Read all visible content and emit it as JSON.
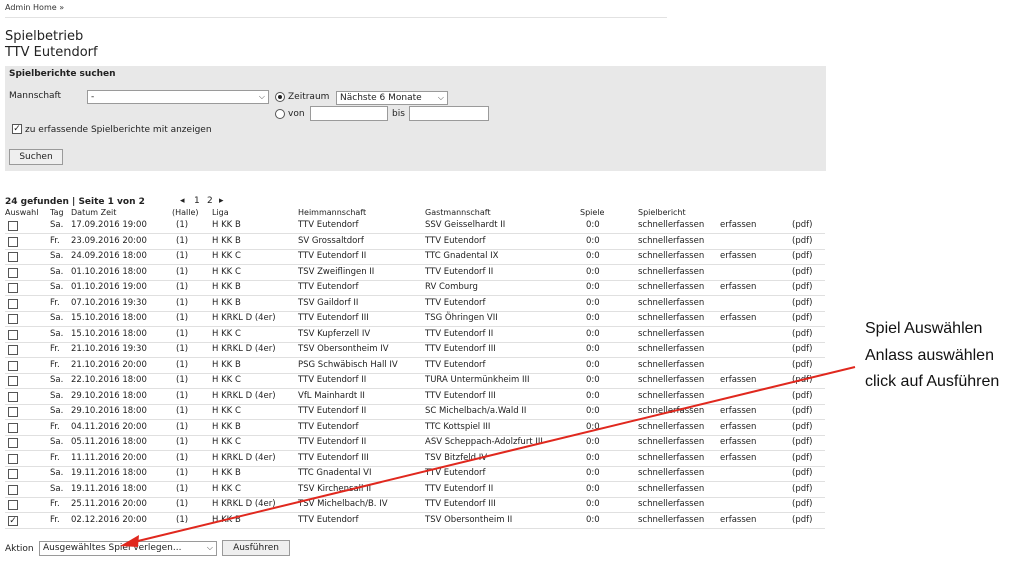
{
  "breadcrumb": "Admin Home »",
  "page": {
    "title": "Spielbetrieb",
    "subtitle": "TTV Eutendorf"
  },
  "search": {
    "title": "Spielberichte suchen",
    "team_label": "Mannschaft",
    "team_value": "-",
    "period_label": "Zeitraum",
    "period_value": "Nächste 6 Monate",
    "from_label": "von",
    "to_label": "bis",
    "include_label": "zu erfassende Spielberichte mit anzeigen",
    "search_button": "Suchen"
  },
  "results": {
    "summary": "24 gefunden | Seite 1 von 2",
    "prev": "◂",
    "page1": "1",
    "page2": "2",
    "next": "▸"
  },
  "table": {
    "headers": {
      "select": "Auswahl",
      "day": "Tag",
      "datetime": "Datum Zeit",
      "hall": "(Halle)",
      "league": "Liga",
      "home": "Heimmannschaft",
      "away": "Gastmannschaft",
      "games": "Spiele",
      "report": "Spielbericht"
    },
    "rows": [
      {
        "day": "Sa.",
        "dt": "17.09.2016 19:00",
        "hall": "(1)",
        "league": "H KK B",
        "home": "TTV Eutendorf",
        "away": "SSV Geisselhardt II",
        "games": "0:0",
        "fast": "schnellerfassen",
        "enter": "erfassen",
        "pdf": "(pdf)",
        "checked": false
      },
      {
        "day": "Fr.",
        "dt": "23.09.2016 20:00",
        "hall": "(1)",
        "league": "H KK B",
        "home": "SV Grossaltdorf",
        "away": "TTV Eutendorf",
        "games": "0:0",
        "fast": "schnellerfassen",
        "enter": "",
        "pdf": "(pdf)",
        "checked": false
      },
      {
        "day": "Sa.",
        "dt": "24.09.2016 18:00",
        "hall": "(1)",
        "league": "H KK C",
        "home": "TTV Eutendorf II",
        "away": "TTC Gnadental IX",
        "games": "0:0",
        "fast": "schnellerfassen",
        "enter": "erfassen",
        "pdf": "(pdf)",
        "checked": false
      },
      {
        "day": "Sa.",
        "dt": "01.10.2016 18:00",
        "hall": "(1)",
        "league": "H KK C",
        "home": "TSV Zweiflingen II",
        "away": "TTV Eutendorf II",
        "games": "0:0",
        "fast": "schnellerfassen",
        "enter": "",
        "pdf": "(pdf)",
        "checked": false
      },
      {
        "day": "Sa.",
        "dt": "01.10.2016 19:00",
        "hall": "(1)",
        "league": "H KK B",
        "home": "TTV Eutendorf",
        "away": "RV Comburg",
        "games": "0:0",
        "fast": "schnellerfassen",
        "enter": "erfassen",
        "pdf": "(pdf)",
        "checked": false
      },
      {
        "day": "Fr.",
        "dt": "07.10.2016 19:30",
        "hall": "(1)",
        "league": "H KK B",
        "home": "TSV Gaildorf II",
        "away": "TTV Eutendorf",
        "games": "0:0",
        "fast": "schnellerfassen",
        "enter": "",
        "pdf": "(pdf)",
        "checked": false
      },
      {
        "day": "Sa.",
        "dt": "15.10.2016 18:00",
        "hall": "(1)",
        "league": "H KRKL D (4er)",
        "home": "TTV Eutendorf III",
        "away": "TSG Öhringen VII",
        "games": "0:0",
        "fast": "schnellerfassen",
        "enter": "erfassen",
        "pdf": "(pdf)",
        "checked": false
      },
      {
        "day": "Sa.",
        "dt": "15.10.2016 18:00",
        "hall": "(1)",
        "league": "H KK C",
        "home": "TSV Kupferzell IV",
        "away": "TTV Eutendorf II",
        "games": "0:0",
        "fast": "schnellerfassen",
        "enter": "",
        "pdf": "(pdf)",
        "checked": false
      },
      {
        "day": "Fr.",
        "dt": "21.10.2016 19:30",
        "hall": "(1)",
        "league": "H KRKL D (4er)",
        "home": "TSV Obersontheim IV",
        "away": "TTV Eutendorf III",
        "games": "0:0",
        "fast": "schnellerfassen",
        "enter": "",
        "pdf": "(pdf)",
        "checked": false
      },
      {
        "day": "Fr.",
        "dt": "21.10.2016 20:00",
        "hall": "(1)",
        "league": "H KK B",
        "home": "PSG Schwäbisch Hall IV",
        "away": "TTV Eutendorf",
        "games": "0:0",
        "fast": "schnellerfassen",
        "enter": "",
        "pdf": "(pdf)",
        "checked": false
      },
      {
        "day": "Sa.",
        "dt": "22.10.2016 18:00",
        "hall": "(1)",
        "league": "H KK C",
        "home": "TTV Eutendorf II",
        "away": "TURA Untermünkheim III",
        "games": "0:0",
        "fast": "schnellerfassen",
        "enter": "erfassen",
        "pdf": "(pdf)",
        "checked": false
      },
      {
        "day": "Sa.",
        "dt": "29.10.2016 18:00",
        "hall": "(1)",
        "league": "H KRKL D (4er)",
        "home": "VfL Mainhardt II",
        "away": "TTV Eutendorf III",
        "games": "0:0",
        "fast": "schnellerfassen",
        "enter": "",
        "pdf": "(pdf)",
        "checked": false
      },
      {
        "day": "Sa.",
        "dt": "29.10.2016 18:00",
        "hall": "(1)",
        "league": "H KK C",
        "home": "TTV Eutendorf II",
        "away": "SC Michelbach/a.Wald II",
        "games": "0:0",
        "fast": "schnellerfassen",
        "enter": "erfassen",
        "pdf": "(pdf)",
        "checked": false
      },
      {
        "day": "Fr.",
        "dt": "04.11.2016 20:00",
        "hall": "(1)",
        "league": "H KK B",
        "home": "TTV Eutendorf",
        "away": "TTC Kottspiel III",
        "games": "0:0",
        "fast": "schnellerfassen",
        "enter": "erfassen",
        "pdf": "(pdf)",
        "checked": false
      },
      {
        "day": "Sa.",
        "dt": "05.11.2016 18:00",
        "hall": "(1)",
        "league": "H KK C",
        "home": "TTV Eutendorf II",
        "away": "ASV Scheppach-Adolzfurt III",
        "games": "0:0",
        "fast": "schnellerfassen",
        "enter": "erfassen",
        "pdf": "(pdf)",
        "checked": false
      },
      {
        "day": "Fr.",
        "dt": "11.11.2016 20:00",
        "hall": "(1)",
        "league": "H KRKL D (4er)",
        "home": "TTV Eutendorf III",
        "away": "TSV Bitzfeld IV",
        "games": "0:0",
        "fast": "schnellerfassen",
        "enter": "erfassen",
        "pdf": "(pdf)",
        "checked": false
      },
      {
        "day": "Sa.",
        "dt": "19.11.2016 18:00",
        "hall": "(1)",
        "league": "H KK B",
        "home": "TTC Gnadental VI",
        "away": "TTV Eutendorf",
        "games": "0:0",
        "fast": "schnellerfassen",
        "enter": "",
        "pdf": "(pdf)",
        "checked": false
      },
      {
        "day": "Sa.",
        "dt": "19.11.2016 18:00",
        "hall": "(1)",
        "league": "H KK C",
        "home": "TSV Kirchensall II",
        "away": "TTV Eutendorf II",
        "games": "0:0",
        "fast": "schnellerfassen",
        "enter": "",
        "pdf": "(pdf)",
        "checked": false
      },
      {
        "day": "Fr.",
        "dt": "25.11.2016 20:00",
        "hall": "(1)",
        "league": "H KRKL D (4er)",
        "home": "TSV Michelbach/B. IV",
        "away": "TTV Eutendorf III",
        "games": "0:0",
        "fast": "schnellerfassen",
        "enter": "",
        "pdf": "(pdf)",
        "checked": false
      },
      {
        "day": "Fr.",
        "dt": "02.12.2016 20:00",
        "hall": "(1)",
        "league": "H KK B",
        "home": "TTV Eutendorf",
        "away": "TSV Obersontheim II",
        "games": "0:0",
        "fast": "schnellerfassen",
        "enter": "erfassen",
        "pdf": "(pdf)",
        "checked": true
      }
    ]
  },
  "action": {
    "label": "Aktion",
    "select_value": "Ausgewähltes Spiel verlegen...",
    "button": "Ausführen"
  },
  "annotations": [
    "Spiel Auswählen",
    "Anlass auswählen",
    "click auf Ausführen"
  ],
  "colors": {
    "panel_bg": "#e8e8e8",
    "arrow": "#e0281e",
    "row_border": "#e0e0e0"
  }
}
